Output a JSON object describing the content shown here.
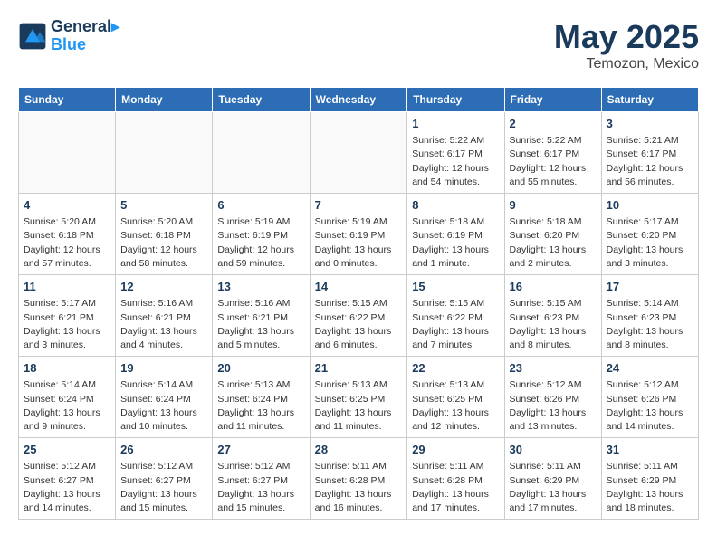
{
  "header": {
    "logo_line1": "General",
    "logo_line2": "Blue",
    "month": "May 2025",
    "location": "Temozon, Mexico"
  },
  "weekdays": [
    "Sunday",
    "Monday",
    "Tuesday",
    "Wednesday",
    "Thursday",
    "Friday",
    "Saturday"
  ],
  "weeks": [
    [
      {
        "day": "",
        "info": ""
      },
      {
        "day": "",
        "info": ""
      },
      {
        "day": "",
        "info": ""
      },
      {
        "day": "",
        "info": ""
      },
      {
        "day": "1",
        "info": "Sunrise: 5:22 AM\nSunset: 6:17 PM\nDaylight: 12 hours\nand 54 minutes."
      },
      {
        "day": "2",
        "info": "Sunrise: 5:22 AM\nSunset: 6:17 PM\nDaylight: 12 hours\nand 55 minutes."
      },
      {
        "day": "3",
        "info": "Sunrise: 5:21 AM\nSunset: 6:17 PM\nDaylight: 12 hours\nand 56 minutes."
      }
    ],
    [
      {
        "day": "4",
        "info": "Sunrise: 5:20 AM\nSunset: 6:18 PM\nDaylight: 12 hours\nand 57 minutes."
      },
      {
        "day": "5",
        "info": "Sunrise: 5:20 AM\nSunset: 6:18 PM\nDaylight: 12 hours\nand 58 minutes."
      },
      {
        "day": "6",
        "info": "Sunrise: 5:19 AM\nSunset: 6:19 PM\nDaylight: 12 hours\nand 59 minutes."
      },
      {
        "day": "7",
        "info": "Sunrise: 5:19 AM\nSunset: 6:19 PM\nDaylight: 13 hours\nand 0 minutes."
      },
      {
        "day": "8",
        "info": "Sunrise: 5:18 AM\nSunset: 6:19 PM\nDaylight: 13 hours\nand 1 minute."
      },
      {
        "day": "9",
        "info": "Sunrise: 5:18 AM\nSunset: 6:20 PM\nDaylight: 13 hours\nand 2 minutes."
      },
      {
        "day": "10",
        "info": "Sunrise: 5:17 AM\nSunset: 6:20 PM\nDaylight: 13 hours\nand 3 minutes."
      }
    ],
    [
      {
        "day": "11",
        "info": "Sunrise: 5:17 AM\nSunset: 6:21 PM\nDaylight: 13 hours\nand 3 minutes."
      },
      {
        "day": "12",
        "info": "Sunrise: 5:16 AM\nSunset: 6:21 PM\nDaylight: 13 hours\nand 4 minutes."
      },
      {
        "day": "13",
        "info": "Sunrise: 5:16 AM\nSunset: 6:21 PM\nDaylight: 13 hours\nand 5 minutes."
      },
      {
        "day": "14",
        "info": "Sunrise: 5:15 AM\nSunset: 6:22 PM\nDaylight: 13 hours\nand 6 minutes."
      },
      {
        "day": "15",
        "info": "Sunrise: 5:15 AM\nSunset: 6:22 PM\nDaylight: 13 hours\nand 7 minutes."
      },
      {
        "day": "16",
        "info": "Sunrise: 5:15 AM\nSunset: 6:23 PM\nDaylight: 13 hours\nand 8 minutes."
      },
      {
        "day": "17",
        "info": "Sunrise: 5:14 AM\nSunset: 6:23 PM\nDaylight: 13 hours\nand 8 minutes."
      }
    ],
    [
      {
        "day": "18",
        "info": "Sunrise: 5:14 AM\nSunset: 6:24 PM\nDaylight: 13 hours\nand 9 minutes."
      },
      {
        "day": "19",
        "info": "Sunrise: 5:14 AM\nSunset: 6:24 PM\nDaylight: 13 hours\nand 10 minutes."
      },
      {
        "day": "20",
        "info": "Sunrise: 5:13 AM\nSunset: 6:24 PM\nDaylight: 13 hours\nand 11 minutes."
      },
      {
        "day": "21",
        "info": "Sunrise: 5:13 AM\nSunset: 6:25 PM\nDaylight: 13 hours\nand 11 minutes."
      },
      {
        "day": "22",
        "info": "Sunrise: 5:13 AM\nSunset: 6:25 PM\nDaylight: 13 hours\nand 12 minutes."
      },
      {
        "day": "23",
        "info": "Sunrise: 5:12 AM\nSunset: 6:26 PM\nDaylight: 13 hours\nand 13 minutes."
      },
      {
        "day": "24",
        "info": "Sunrise: 5:12 AM\nSunset: 6:26 PM\nDaylight: 13 hours\nand 14 minutes."
      }
    ],
    [
      {
        "day": "25",
        "info": "Sunrise: 5:12 AM\nSunset: 6:27 PM\nDaylight: 13 hours\nand 14 minutes."
      },
      {
        "day": "26",
        "info": "Sunrise: 5:12 AM\nSunset: 6:27 PM\nDaylight: 13 hours\nand 15 minutes."
      },
      {
        "day": "27",
        "info": "Sunrise: 5:12 AM\nSunset: 6:27 PM\nDaylight: 13 hours\nand 15 minutes."
      },
      {
        "day": "28",
        "info": "Sunrise: 5:11 AM\nSunset: 6:28 PM\nDaylight: 13 hours\nand 16 minutes."
      },
      {
        "day": "29",
        "info": "Sunrise: 5:11 AM\nSunset: 6:28 PM\nDaylight: 13 hours\nand 17 minutes."
      },
      {
        "day": "30",
        "info": "Sunrise: 5:11 AM\nSunset: 6:29 PM\nDaylight: 13 hours\nand 17 minutes."
      },
      {
        "day": "31",
        "info": "Sunrise: 5:11 AM\nSunset: 6:29 PM\nDaylight: 13 hours\nand 18 minutes."
      }
    ]
  ]
}
